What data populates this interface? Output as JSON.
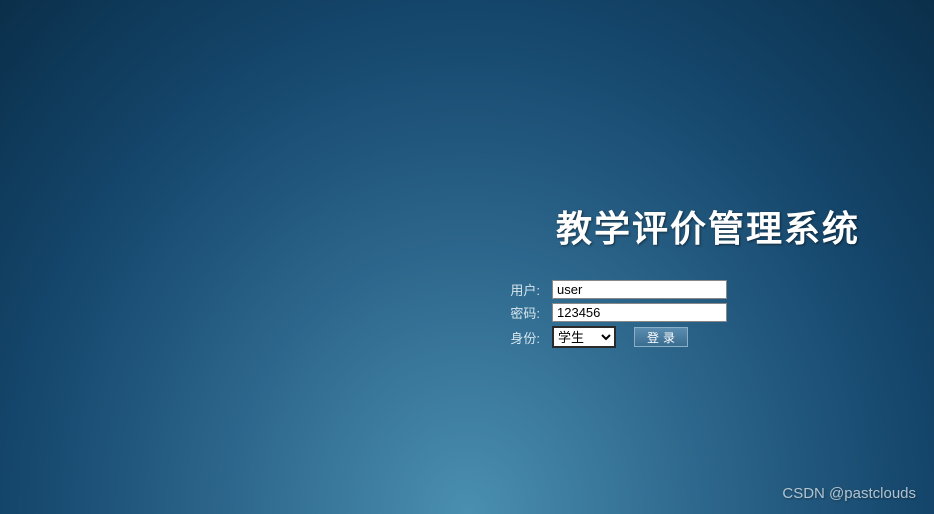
{
  "title": "教学评价管理系统",
  "form": {
    "user_label": "用户:",
    "user_value": "user",
    "password_label": "密码:",
    "password_value": "123456",
    "role_label": "身份:",
    "role_selected": "学生",
    "login_button": "登录"
  },
  "watermark": "CSDN @pastclouds"
}
